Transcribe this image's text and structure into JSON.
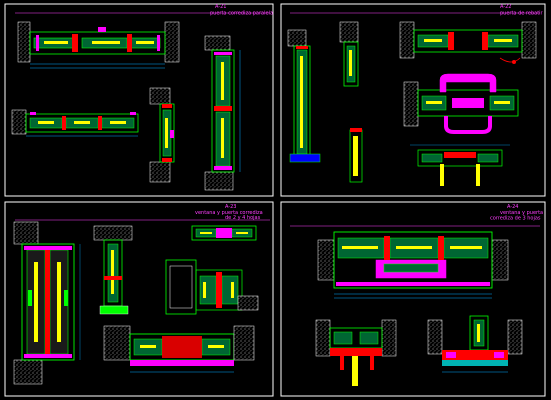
{
  "sheets": [
    {
      "id": "top-left",
      "title": "puerta corrediza paralela",
      "code": "A-21"
    },
    {
      "id": "top-right",
      "title": "puerta de rebatir",
      "code": "A-22"
    },
    {
      "id": "bottom-left",
      "title_line1": "ventana y puerta corrediza",
      "title_line2": "de 2 y 4 hojas",
      "code": "A-23"
    },
    {
      "id": "bottom-right",
      "title_line1": "ventana y puerta",
      "title_line2": "corrediza de 3 hojas",
      "code": "A-24"
    }
  ],
  "palette": {
    "background": "#000000",
    "frame": "#ffffff",
    "profile": "#00ff00",
    "hardware": "#ffff00",
    "seal": "#ff0000",
    "cut": "#ff00ff",
    "glass": "#00ffff",
    "masonry": "#ffffff",
    "dim": "#00a8ff"
  }
}
